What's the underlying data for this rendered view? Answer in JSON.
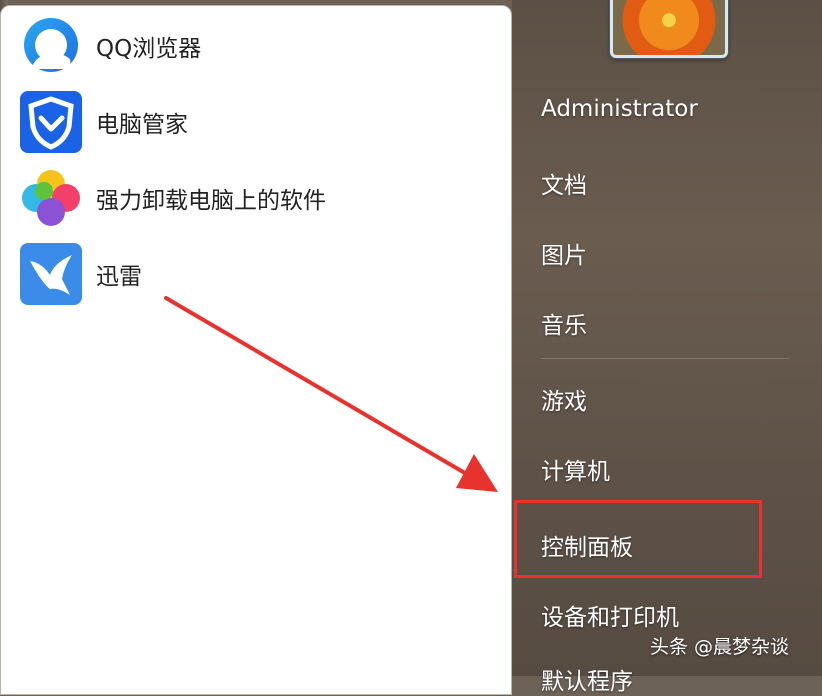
{
  "programs": [
    {
      "label": "QQ浏览器",
      "icon": "qq-browser-icon"
    },
    {
      "label": "电脑管家",
      "icon": "pc-manager-icon"
    },
    {
      "label": "强力卸载电脑上的软件",
      "icon": "uninstaller-icon"
    },
    {
      "label": "迅雷",
      "icon": "xunlei-icon"
    }
  ],
  "right_menu": {
    "user": "Administrator",
    "documents": "文档",
    "pictures": "图片",
    "music": "音乐",
    "games": "游戏",
    "computer": "计算机",
    "control_panel": "控制面板",
    "devices_printers": "设备和打印机",
    "default_programs": "默认程序"
  },
  "watermark": "头条 @晨梦杂谈",
  "colors": {
    "highlight": "#e8322e",
    "arrow": "#e8322e"
  }
}
